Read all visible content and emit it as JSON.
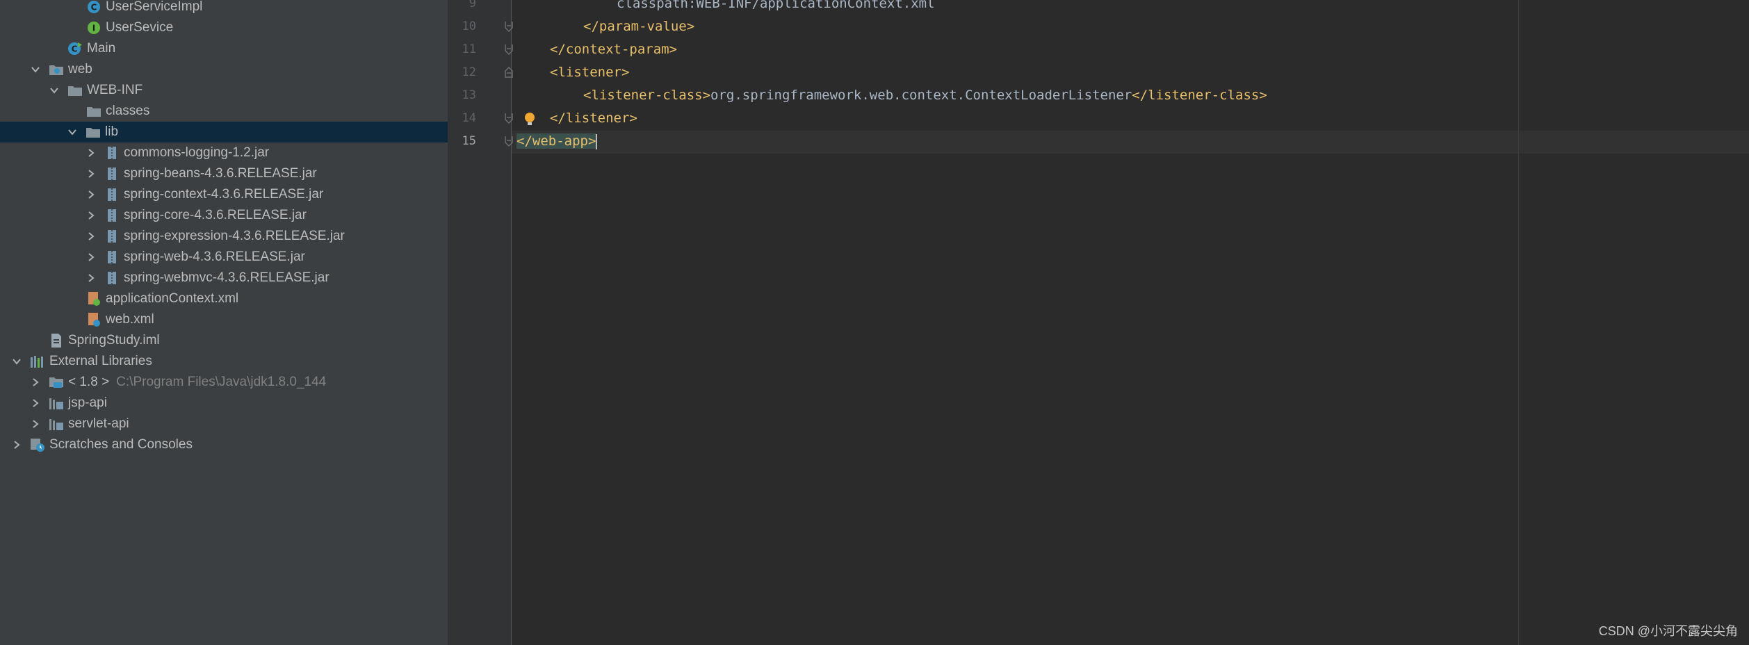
{
  "project_tree": {
    "items": [
      {
        "label": "UserServiceImpl",
        "hint": "",
        "icon": "java-class-icon",
        "selected": false
      },
      {
        "label": "UserSevice",
        "hint": "",
        "icon": "java-interface-icon",
        "selected": false
      },
      {
        "label": "Main",
        "hint": "",
        "icon": "java-main-class-icon",
        "selected": false
      },
      {
        "label": "web",
        "hint": "",
        "icon": "web-folder-icon",
        "selected": false
      },
      {
        "label": "WEB-INF",
        "hint": "",
        "icon": "folder-icon",
        "selected": false
      },
      {
        "label": "classes",
        "hint": "",
        "icon": "folder-icon",
        "selected": false
      },
      {
        "label": "lib",
        "hint": "",
        "icon": "folder-icon",
        "selected": true
      },
      {
        "label": "commons-logging-1.2.jar",
        "hint": "",
        "icon": "jar-icon",
        "selected": false
      },
      {
        "label": "spring-beans-4.3.6.RELEASE.jar",
        "hint": "",
        "icon": "jar-icon",
        "selected": false
      },
      {
        "label": "spring-context-4.3.6.RELEASE.jar",
        "hint": "",
        "icon": "jar-icon",
        "selected": false
      },
      {
        "label": "spring-core-4.3.6.RELEASE.jar",
        "hint": "",
        "icon": "jar-icon",
        "selected": false
      },
      {
        "label": "spring-expression-4.3.6.RELEASE.jar",
        "hint": "",
        "icon": "jar-icon",
        "selected": false
      },
      {
        "label": "spring-web-4.3.6.RELEASE.jar",
        "hint": "",
        "icon": "jar-icon",
        "selected": false
      },
      {
        "label": "spring-webmvc-4.3.6.RELEASE.jar",
        "hint": "",
        "icon": "jar-icon",
        "selected": false
      },
      {
        "label": "applicationContext.xml",
        "hint": "",
        "icon": "spring-xml-icon",
        "selected": false
      },
      {
        "label": "web.xml",
        "hint": "",
        "icon": "web-xml-icon",
        "selected": false
      },
      {
        "label": "SpringStudy.iml",
        "hint": "",
        "icon": "iml-file-icon",
        "selected": false
      },
      {
        "label": "External Libraries",
        "hint": "",
        "icon": "libraries-icon",
        "selected": false
      },
      {
        "label": "< 1.8 >",
        "hint": "C:\\Program Files\\Java\\jdk1.8.0_144",
        "icon": "jdk-icon",
        "selected": false
      },
      {
        "label": "jsp-api",
        "hint": "",
        "icon": "library-icon",
        "selected": false
      },
      {
        "label": "servlet-api",
        "hint": "",
        "icon": "library-icon",
        "selected": false
      },
      {
        "label": "Scratches and Consoles",
        "hint": "",
        "icon": "scratches-icon",
        "selected": false
      }
    ]
  },
  "editor": {
    "lines": [
      {
        "num": "9",
        "parts": [
          {
            "t": "classpath:WEB-INF/applicationContext.xml",
            "c": "txt"
          }
        ]
      },
      {
        "num": "10",
        "parts": [
          {
            "t": "</param-value>",
            "c": "tag"
          }
        ]
      },
      {
        "num": "11",
        "parts": [
          {
            "t": "</context-param>",
            "c": "tag"
          }
        ]
      },
      {
        "num": "12",
        "parts": [
          {
            "t": "<listener>",
            "c": "tag"
          }
        ]
      },
      {
        "num": "13",
        "parts": [
          {
            "t": "<listener-class>",
            "c": "tag"
          },
          {
            "t": "org.springframework.web.context.ContextLoaderListener",
            "c": "txt"
          },
          {
            "t": "</listener-class>",
            "c": "tag"
          }
        ]
      },
      {
        "num": "14",
        "parts": [
          {
            "t": "</listener>",
            "c": "tag"
          }
        ]
      },
      {
        "num": "15",
        "parts": [
          {
            "t": "</web-app>",
            "c": "tag match"
          }
        ]
      }
    ],
    "current_line": "15"
  },
  "watermark": "CSDN @小河不露尖尖角"
}
